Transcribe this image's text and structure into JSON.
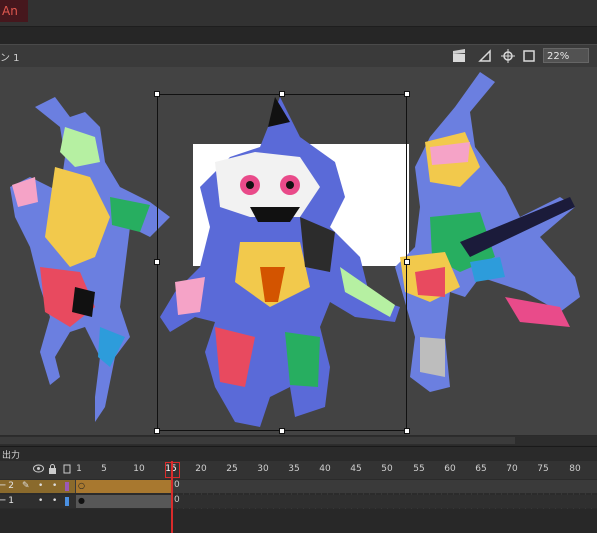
{
  "app": {
    "logo_text": "An"
  },
  "scene": {
    "label": "ン 1"
  },
  "toolbar": {
    "zoom_value": "22%",
    "icons": [
      "clapperboard-icon",
      "stage-rotate-icon",
      "center-stage-icon",
      "clip-icon"
    ]
  },
  "timeline": {
    "title": "出力",
    "frame_numbers": [
      "1",
      "5",
      "10",
      "15",
      "20",
      "25",
      "30",
      "35",
      "40",
      "45",
      "50",
      "55",
      "60",
      "65",
      "70",
      "75",
      "80"
    ],
    "current_frame": "15",
    "layers": [
      {
        "name": "2",
        "row_marker": "─ 2",
        "color": "#9b59b6"
      },
      {
        "name": "1",
        "row_marker": "─ 1",
        "color": "#4a90e2"
      }
    ],
    "layer2_frame_mark": "0",
    "layer1_frame_mark": "0"
  }
}
